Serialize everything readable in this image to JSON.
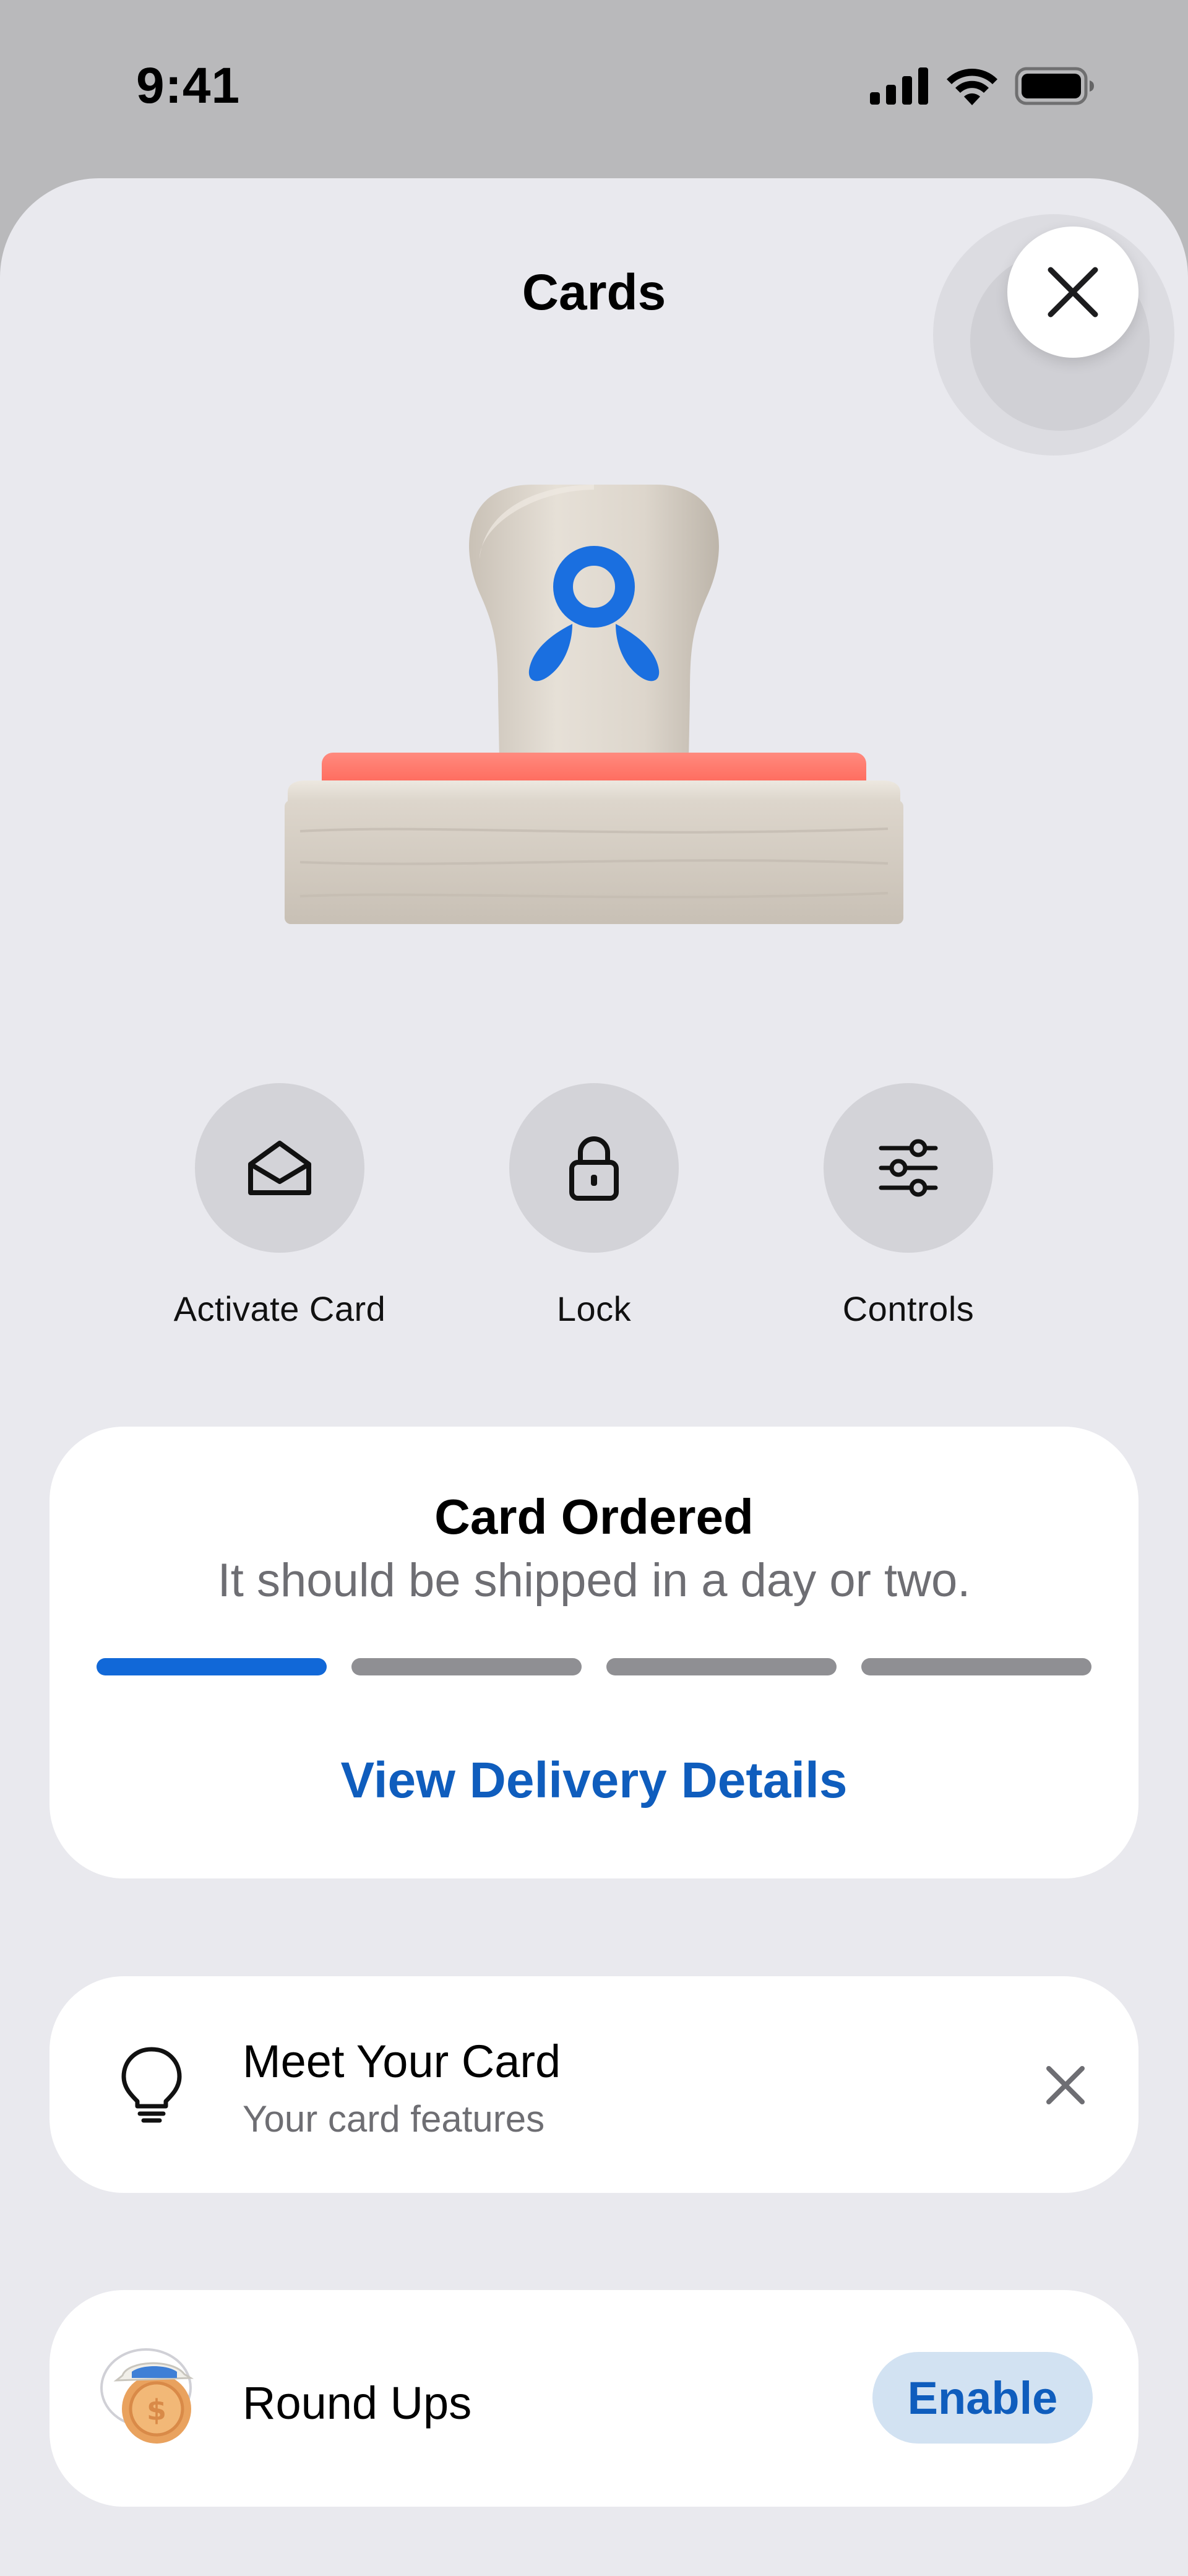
{
  "status_bar": {
    "time": "9:41",
    "icons": [
      "cellular-signal-icon",
      "wifi-icon",
      "battery-icon"
    ]
  },
  "sheet": {
    "title": "Cards",
    "close_icon": "close-icon"
  },
  "illustration": {
    "name": "card-stamp-illustration",
    "colors": {
      "handle": "#ddd6cc",
      "pad": "#ff6f61",
      "logo": "#1a6fe0"
    }
  },
  "actions": [
    {
      "label": "Activate Card",
      "icon": "envelope-open-icon"
    },
    {
      "label": "Lock",
      "icon": "lock-icon"
    },
    {
      "label": "Controls",
      "icon": "sliders-icon"
    }
  ],
  "order_status": {
    "title": "Card Ordered",
    "subtitle": "It should be shipped in a day or two.",
    "steps_total": 4,
    "steps_completed": 1,
    "link_label": "View Delivery Details"
  },
  "meet_card": {
    "title": "Meet Your Card",
    "subtitle": "Your card features",
    "icon": "lightbulb-icon",
    "dismiss_icon": "close-icon"
  },
  "round_ups": {
    "title": "Round Ups",
    "icon": "piggy-coin-icon",
    "button_label": "Enable"
  },
  "colors": {
    "accent": "#0f5dbd",
    "progress_active": "#1168d8",
    "progress_inactive": "#8f8f93",
    "sheet_background": "#e9e9ee",
    "enable_background": "#d2e2f2"
  }
}
